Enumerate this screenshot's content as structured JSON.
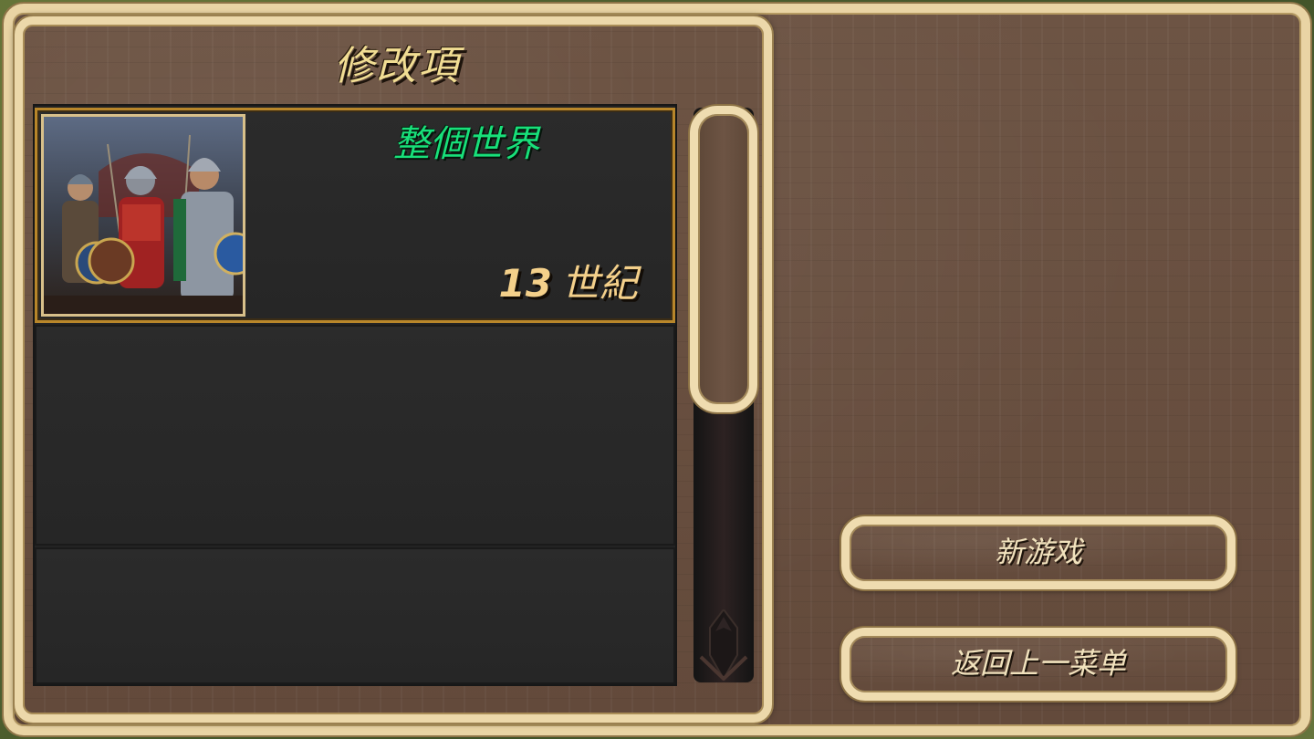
{
  "panel": {
    "title": "修改項"
  },
  "mods": [
    {
      "title": "整個世界",
      "century_number": "13",
      "century_label": "世紀",
      "selected": true
    }
  ],
  "buttons": {
    "new_game": "新游戏",
    "back": "返回上一菜单"
  },
  "colors": {
    "frame": "#ecd8aa",
    "wood": "#6a5241",
    "mod_title": "#18e07a",
    "century": "#f4d08a",
    "selection_border": "#b8862a"
  }
}
